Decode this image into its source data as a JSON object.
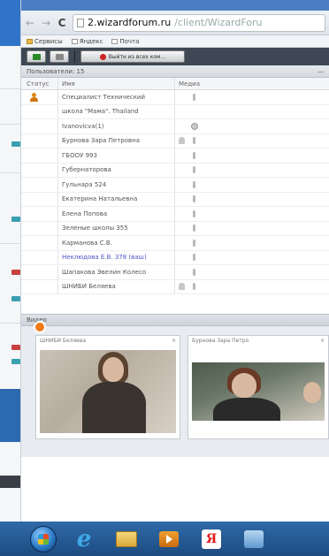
{
  "browser": {
    "url_host": "2.wizardforum.ru",
    "url_path": "/client/WizardForu",
    "bookmarks": [
      "Сервисы",
      "Яндекс",
      "Почта"
    ]
  },
  "toolbar": {
    "exit_label": "Выйти из всех ком..."
  },
  "users_panel": {
    "title": "Пользователи: 15",
    "columns": {
      "status": "Статус",
      "name": "Имя",
      "media": "Медиа"
    },
    "users": [
      {
        "name": "Специалист Технический",
        "status": "active",
        "mic": true,
        "cam": false
      },
      {
        "name": "школа \"Мама\". Thailand",
        "status": "",
        "mic": false,
        "cam": false
      },
      {
        "name": "Ivanovicva(1)",
        "status": "",
        "mic": false,
        "cam": true
      },
      {
        "name": "Бурнова Зара Петровна",
        "status": "",
        "mic": true,
        "cam": false,
        "user": true
      },
      {
        "name": "ГБООУ 993",
        "status": "",
        "mic": true,
        "cam": false
      },
      {
        "name": "Губернаторова",
        "status": "",
        "mic": true,
        "cam": false
      },
      {
        "name": "Гульнара 524",
        "status": "",
        "mic": true,
        "cam": false
      },
      {
        "name": "Екатерина Натальевна",
        "status": "",
        "mic": true,
        "cam": false
      },
      {
        "name": "Елена Попова",
        "status": "",
        "mic": true,
        "cam": false
      },
      {
        "name": "Зеленые школы 355",
        "status": "",
        "mic": true,
        "cam": false
      },
      {
        "name": "Карманова С.В.",
        "status": "",
        "mic": true,
        "cam": false
      },
      {
        "name": "Неклюдова Е.В. 378 (ваш)",
        "status": "",
        "mic": true,
        "cam": false,
        "highlight": true
      },
      {
        "name": "Шапакова Эвелин Колесо",
        "status": "",
        "mic": true,
        "cam": false
      },
      {
        "name": "ШНИБИ Беляева",
        "status": "",
        "mic": true,
        "cam": false,
        "user": true
      }
    ]
  },
  "video_panel": {
    "title": "Видео",
    "tiles": [
      {
        "label": "ШНИБИ Беляева"
      },
      {
        "label": "Бурнова Зара Петро"
      }
    ]
  },
  "colors": {
    "taskbar": "#1d4b80",
    "toolbar": "#3e4854",
    "highlight_user": "#4a56c8",
    "status_active": "#e08a18"
  }
}
